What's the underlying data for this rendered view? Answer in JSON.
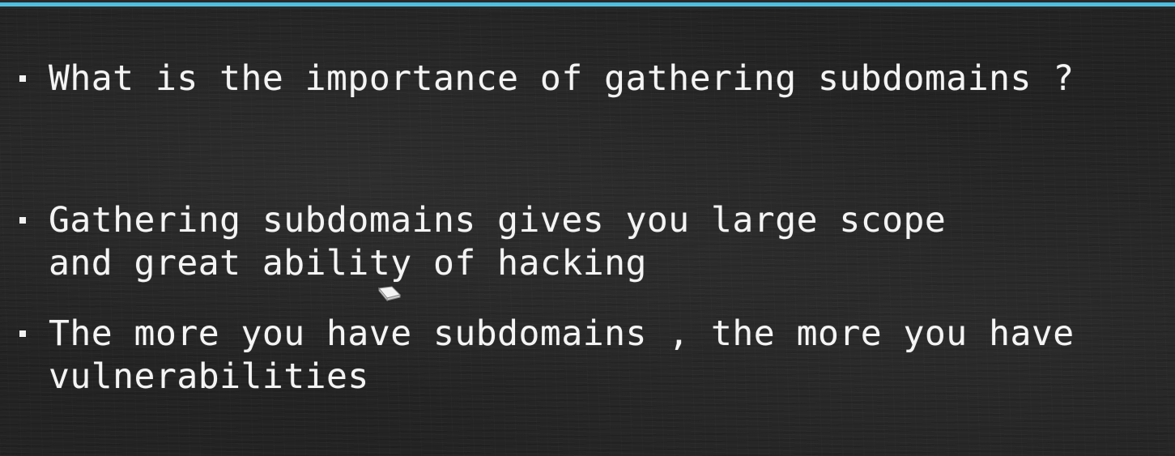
{
  "slide": {
    "accent_color": "#4cc3e6",
    "bullets": [
      {
        "text": "What is the importance of gathering subdomains ?"
      },
      {
        "text": "Gathering subdomains gives you large scope\nand great ability of hacking"
      },
      {
        "text": "The more you have subdomains , the more you have\nvulnerabilities"
      }
    ],
    "cursor_icon": "eraser-cursor-icon"
  }
}
